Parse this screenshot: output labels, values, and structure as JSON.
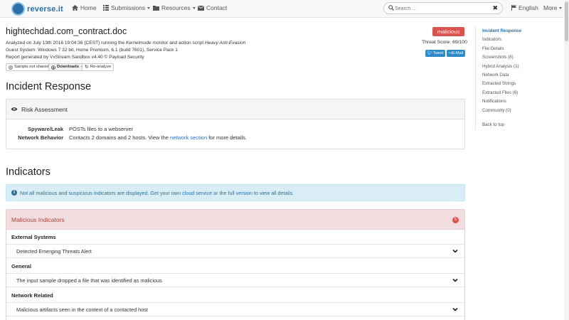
{
  "nav": {
    "brand": "reverse.it",
    "items": [
      {
        "label": "Home",
        "icon": "home-icon"
      },
      {
        "label": "Submissions",
        "icon": "list-icon"
      },
      {
        "label": "Resources",
        "icon": "folder-icon"
      },
      {
        "label": "Contact",
        "icon": "envelope-icon"
      }
    ],
    "search_placeholder": "Search ...",
    "language": "English",
    "more": "More"
  },
  "report": {
    "title": "hightechdad.com_contract.doc",
    "analyzed_prefix": "Analyzed on July 13th 2016 19:04:36 (CEST) running the ",
    "analyzed_monitor": "Kernelmode",
    "analyzed_mid": " monitor and action script ",
    "analyzed_script": "Heavy Anti-Evasion",
    "guest_system": "Guest System: Windows 7 32 bit, Home Premium, 6.1 (build 7601), Service Pack 1",
    "generated_by": "Report generated by VxStream Sandbox v4.40 © Payload Security",
    "verdict": "malicious",
    "threat_score": "Threat Score: 69/100",
    "tweet": "Tweet",
    "email": "E-Mail",
    "btn_not_shared": "Sample not shared",
    "btn_downloads": "Downloads",
    "btn_reanalyze": "Re-analyze"
  },
  "incident": {
    "heading": "Incident Response",
    "panel_title": "Risk Assessment",
    "rows": [
      {
        "label": "Spyware/Leak",
        "value": "POSTs files to a webserver"
      },
      {
        "label": "Network Behavior",
        "value_prefix": "Contacts 2 domains and 2 hosts. View the ",
        "link": "network section",
        "value_suffix": " for more details."
      }
    ]
  },
  "indicators": {
    "heading": "Indicators",
    "info_prefix": "Not all malicious and suspicious indicators are displayed. Get your own ",
    "info_link1": "cloud service",
    "info_mid": " or the ",
    "info_link2": "full version",
    "info_suffix": " to view all details.",
    "malicious_title": "Malicious Indicators",
    "malicious_count": "5",
    "groups": [
      {
        "title": "External Systems",
        "item": "Detected Emerging Threats Alert"
      },
      {
        "title": "General",
        "item": "The input sample dropped a file that was identified as malicious"
      },
      {
        "title": "Network Related",
        "item": "Malicious artifacts seen in the context of a contacted host"
      }
    ]
  },
  "sidebar": {
    "items": [
      "Incident Response",
      "Indicators",
      "File Details",
      "Screenshots (8)",
      "Hybrid Analysis (1)",
      "Network Data",
      "Extracted Strings",
      "Extracted Files (6)",
      "Notifications",
      "Community (0)"
    ],
    "back_to_top": "Back to top"
  },
  "colors": {
    "malicious": "#d9534f",
    "link": "#2b72b5",
    "info_bg": "#d9edf7",
    "danger_bg": "#f2dede"
  }
}
